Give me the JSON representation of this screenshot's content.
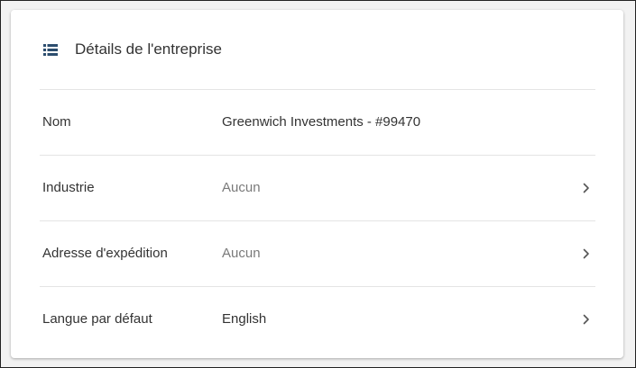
{
  "card": {
    "title": "Détails de l'entreprise",
    "icon": "list-icon",
    "accent_color": "#2c4d6e"
  },
  "rows": [
    {
      "label": "Nom",
      "value": "Greenwich Investments - #99470",
      "muted": false,
      "has_chevron": false
    },
    {
      "label": "Industrie",
      "value": "Aucun",
      "muted": true,
      "has_chevron": true
    },
    {
      "label": "Adresse d'expédition",
      "value": "Aucun",
      "muted": true,
      "has_chevron": true
    },
    {
      "label": "Langue par défaut",
      "value": "English",
      "muted": false,
      "has_chevron": true
    }
  ]
}
